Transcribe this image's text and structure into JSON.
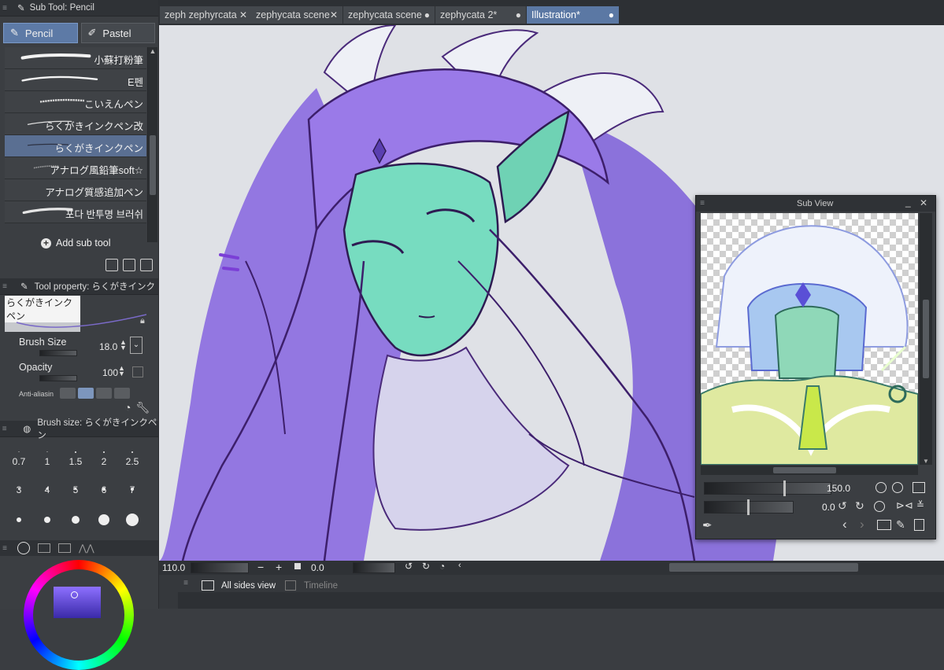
{
  "sub_tool": {
    "header": "Sub Tool: Pencil",
    "tabs": [
      {
        "label": "Pencil",
        "active": true
      },
      {
        "label": "Pastel",
        "active": false
      }
    ],
    "brushes": [
      {
        "label": "小蘇打粉筆"
      },
      {
        "label": "E펜"
      },
      {
        "label": "こいえんペン"
      },
      {
        "label": "らくがきインクペン改"
      },
      {
        "label": "らくがきインクペン",
        "selected": true
      },
      {
        "label": "アナログ風鉛筆soft☆"
      },
      {
        "label": "アナログ質感追加ペン"
      },
      {
        "label": "포다 반투명 브러쉬"
      }
    ],
    "add_label": "Add sub tool"
  },
  "tool_property": {
    "header": "Tool property: らくがきインク",
    "preview_label": "らくがきインクペン",
    "brush_size_label": "Brush Size",
    "brush_size_value": "18.0",
    "opacity_label": "Opacity",
    "opacity_value": "100",
    "antialias_label": "Anti-aliasin"
  },
  "brush_size_panel": {
    "header": "Brush size: らくがきインクペン",
    "sizes": [
      "0.7",
      "1",
      "1.5",
      "2",
      "2.5",
      "3",
      "4",
      "5",
      "6",
      "7",
      "",
      "",
      "",
      "",
      ""
    ]
  },
  "doc_tabs": [
    {
      "label": "zeph zephyrcata",
      "close": "✕"
    },
    {
      "label": "zephycata scene",
      "close": "✕"
    },
    {
      "label": "zephycata scene",
      "close": "●"
    },
    {
      "label": "zephycata 2*",
      "close": "●"
    },
    {
      "label": "Illustration*",
      "close": "●",
      "active": true
    }
  ],
  "status_bar": {
    "zoom": "110.0",
    "rotation": "0.0"
  },
  "timeline": {
    "all_sides_label": "All sides view",
    "timeline_label": "Timeline"
  },
  "sub_view": {
    "title": "Sub View",
    "zoom_value": "150.0",
    "rotate_value": "0.0"
  },
  "colors": {
    "accent": "#5b78a4",
    "panel": "#3b3e42",
    "canvas": "#dfe1e6"
  }
}
